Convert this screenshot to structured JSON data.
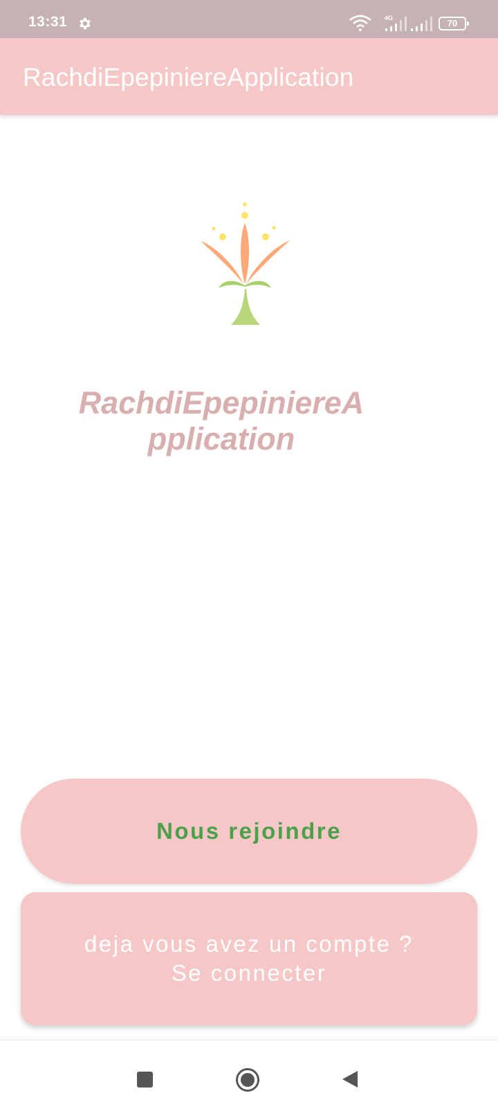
{
  "status_bar": {
    "time": "13:31",
    "network_label": "4G",
    "battery_level": "70",
    "icons": [
      "gear-icon",
      "wifi-icon",
      "signal-4g-icon",
      "signal-icon",
      "battery-icon"
    ]
  },
  "app_bar": {
    "title": "RachdiEpepiniereApplication"
  },
  "main": {
    "logo_icon": "plant-logo-icon",
    "app_name": "RachdiEpepiniereApplication"
  },
  "actions": {
    "join_label": "Nous rejoindre",
    "login_label": "deja vous avez un compte ?\nSe connecter"
  },
  "nav_bar": {
    "icons": [
      "recents-icon",
      "home-icon",
      "back-icon"
    ]
  },
  "colors": {
    "status_bar_bg": "#c6b2b2",
    "primary": "#f5c8c7",
    "app_name_text": "#d9aeae",
    "join_text": "#4ca04a",
    "login_text": "#ffffff",
    "nav_icon": "#555555"
  }
}
